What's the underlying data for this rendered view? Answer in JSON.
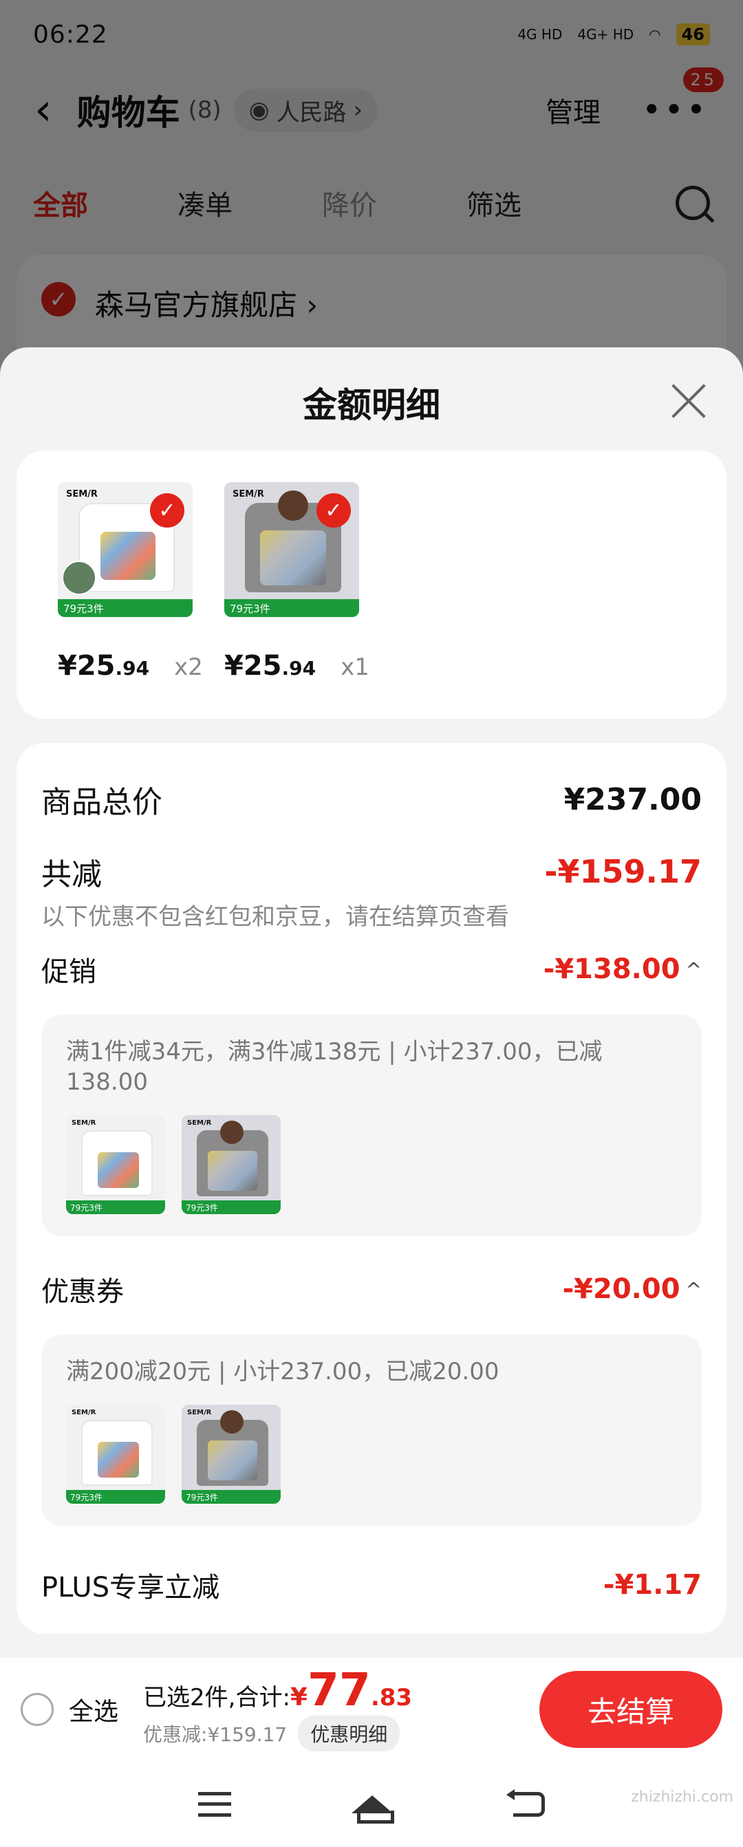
{
  "status_bar": {
    "time": "06:22",
    "network1": "4G HD",
    "network2": "4G+ HD",
    "battery": "46"
  },
  "nav": {
    "back": "‹",
    "title": "购物车",
    "count": "(8)",
    "location": "人民路",
    "location_caret": "›",
    "manage": "管理",
    "more": "•••",
    "badge": "25"
  },
  "tabs": [
    "全部",
    "凑单",
    "降价",
    "筛选"
  ],
  "shop": {
    "name": "森马官方旗舰店",
    "caret": "›"
  },
  "sheet": {
    "title": "金额明细",
    "items": [
      {
        "brand": "SEM/R",
        "tag": "79元3件",
        "price": "¥25",
        "price_dec": ".94",
        "qty": "x2"
      },
      {
        "brand": "SEM/R",
        "tag": "79元3件",
        "price": "¥25",
        "price_dec": ".94",
        "qty": "x1"
      }
    ],
    "total_label": "商品总价",
    "total_value": "¥237.00",
    "reduce_label": "共减",
    "reduce_value": "-¥159.17",
    "reduce_note": "以下优惠不包含红包和京豆，请在结算页查看",
    "promo_label": "促销",
    "promo_value": "-¥138.00",
    "promo_desc": "满1件减34元，满3件减138元 | 小计237.00，已减138.00",
    "coupon_label": "优惠券",
    "coupon_value": "-¥20.00",
    "coupon_desc": "满200减20元 | 小计237.00，已减20.00",
    "plus_label": "PLUS专享立减",
    "plus_value": "-¥1.17",
    "caret_up": "^"
  },
  "checkout": {
    "select_all": "全选",
    "selected": "已选2件,合计:",
    "currency": "¥",
    "total_int": "77",
    "total_dec": ".83",
    "discount": "优惠减:¥159.17",
    "detail_btn": "优惠明细",
    "pay_btn": "去结算"
  },
  "watermark": "zhizhizhi.com",
  "colors": {
    "accent": "#e2231a",
    "promo_tag": "#1a9a3b",
    "pay_button": "#f0302f"
  }
}
